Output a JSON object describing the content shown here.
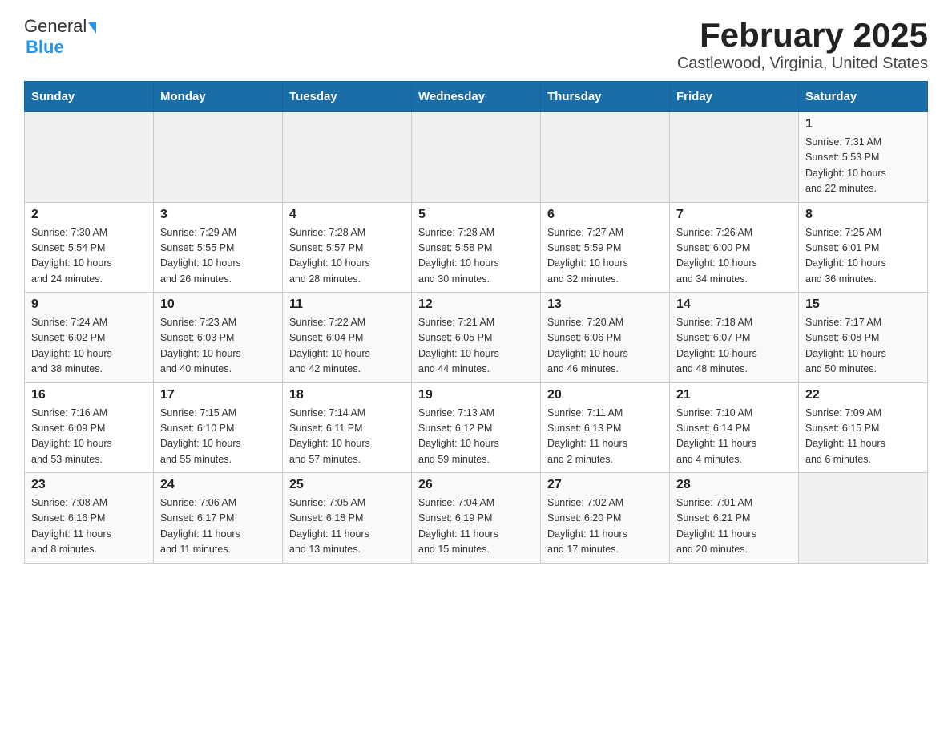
{
  "header": {
    "logo_general": "General",
    "logo_blue": "Blue",
    "title": "February 2025",
    "subtitle": "Castlewood, Virginia, United States"
  },
  "days_of_week": [
    "Sunday",
    "Monday",
    "Tuesday",
    "Wednesday",
    "Thursday",
    "Friday",
    "Saturday"
  ],
  "weeks": [
    [
      {
        "day": "",
        "info": ""
      },
      {
        "day": "",
        "info": ""
      },
      {
        "day": "",
        "info": ""
      },
      {
        "day": "",
        "info": ""
      },
      {
        "day": "",
        "info": ""
      },
      {
        "day": "",
        "info": ""
      },
      {
        "day": "1",
        "info": "Sunrise: 7:31 AM\nSunset: 5:53 PM\nDaylight: 10 hours\nand 22 minutes."
      }
    ],
    [
      {
        "day": "2",
        "info": "Sunrise: 7:30 AM\nSunset: 5:54 PM\nDaylight: 10 hours\nand 24 minutes."
      },
      {
        "day": "3",
        "info": "Sunrise: 7:29 AM\nSunset: 5:55 PM\nDaylight: 10 hours\nand 26 minutes."
      },
      {
        "day": "4",
        "info": "Sunrise: 7:28 AM\nSunset: 5:57 PM\nDaylight: 10 hours\nand 28 minutes."
      },
      {
        "day": "5",
        "info": "Sunrise: 7:28 AM\nSunset: 5:58 PM\nDaylight: 10 hours\nand 30 minutes."
      },
      {
        "day": "6",
        "info": "Sunrise: 7:27 AM\nSunset: 5:59 PM\nDaylight: 10 hours\nand 32 minutes."
      },
      {
        "day": "7",
        "info": "Sunrise: 7:26 AM\nSunset: 6:00 PM\nDaylight: 10 hours\nand 34 minutes."
      },
      {
        "day": "8",
        "info": "Sunrise: 7:25 AM\nSunset: 6:01 PM\nDaylight: 10 hours\nand 36 minutes."
      }
    ],
    [
      {
        "day": "9",
        "info": "Sunrise: 7:24 AM\nSunset: 6:02 PM\nDaylight: 10 hours\nand 38 minutes."
      },
      {
        "day": "10",
        "info": "Sunrise: 7:23 AM\nSunset: 6:03 PM\nDaylight: 10 hours\nand 40 minutes."
      },
      {
        "day": "11",
        "info": "Sunrise: 7:22 AM\nSunset: 6:04 PM\nDaylight: 10 hours\nand 42 minutes."
      },
      {
        "day": "12",
        "info": "Sunrise: 7:21 AM\nSunset: 6:05 PM\nDaylight: 10 hours\nand 44 minutes."
      },
      {
        "day": "13",
        "info": "Sunrise: 7:20 AM\nSunset: 6:06 PM\nDaylight: 10 hours\nand 46 minutes."
      },
      {
        "day": "14",
        "info": "Sunrise: 7:18 AM\nSunset: 6:07 PM\nDaylight: 10 hours\nand 48 minutes."
      },
      {
        "day": "15",
        "info": "Sunrise: 7:17 AM\nSunset: 6:08 PM\nDaylight: 10 hours\nand 50 minutes."
      }
    ],
    [
      {
        "day": "16",
        "info": "Sunrise: 7:16 AM\nSunset: 6:09 PM\nDaylight: 10 hours\nand 53 minutes."
      },
      {
        "day": "17",
        "info": "Sunrise: 7:15 AM\nSunset: 6:10 PM\nDaylight: 10 hours\nand 55 minutes."
      },
      {
        "day": "18",
        "info": "Sunrise: 7:14 AM\nSunset: 6:11 PM\nDaylight: 10 hours\nand 57 minutes."
      },
      {
        "day": "19",
        "info": "Sunrise: 7:13 AM\nSunset: 6:12 PM\nDaylight: 10 hours\nand 59 minutes."
      },
      {
        "day": "20",
        "info": "Sunrise: 7:11 AM\nSunset: 6:13 PM\nDaylight: 11 hours\nand 2 minutes."
      },
      {
        "day": "21",
        "info": "Sunrise: 7:10 AM\nSunset: 6:14 PM\nDaylight: 11 hours\nand 4 minutes."
      },
      {
        "day": "22",
        "info": "Sunrise: 7:09 AM\nSunset: 6:15 PM\nDaylight: 11 hours\nand 6 minutes."
      }
    ],
    [
      {
        "day": "23",
        "info": "Sunrise: 7:08 AM\nSunset: 6:16 PM\nDaylight: 11 hours\nand 8 minutes."
      },
      {
        "day": "24",
        "info": "Sunrise: 7:06 AM\nSunset: 6:17 PM\nDaylight: 11 hours\nand 11 minutes."
      },
      {
        "day": "25",
        "info": "Sunrise: 7:05 AM\nSunset: 6:18 PM\nDaylight: 11 hours\nand 13 minutes."
      },
      {
        "day": "26",
        "info": "Sunrise: 7:04 AM\nSunset: 6:19 PM\nDaylight: 11 hours\nand 15 minutes."
      },
      {
        "day": "27",
        "info": "Sunrise: 7:02 AM\nSunset: 6:20 PM\nDaylight: 11 hours\nand 17 minutes."
      },
      {
        "day": "28",
        "info": "Sunrise: 7:01 AM\nSunset: 6:21 PM\nDaylight: 11 hours\nand 20 minutes."
      },
      {
        "day": "",
        "info": ""
      }
    ]
  ]
}
